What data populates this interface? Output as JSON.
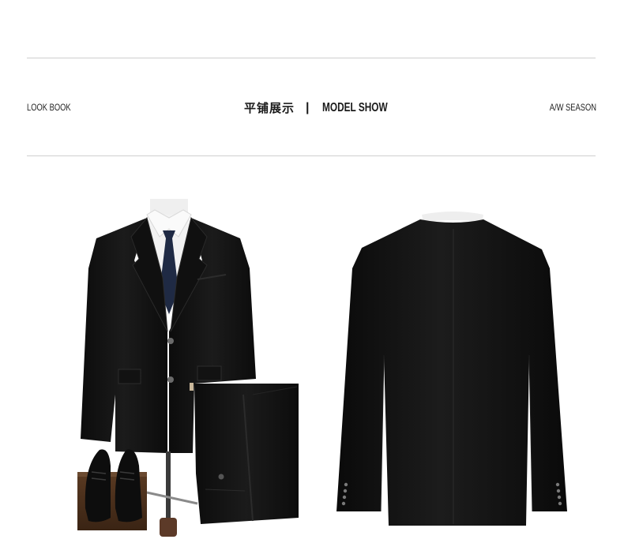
{
  "header": {
    "left_label": "LOOK BOOK",
    "title_cn": "平铺展示",
    "separator": "|",
    "title_en": "MODEL SHOW",
    "right_label": "A/W SEASON"
  },
  "colors": {
    "suit": "#141414",
    "tie": "#1f2a44",
    "shirt": "#f2f2f2",
    "divider": "#cfcfcf",
    "text": "#1a1a1a"
  }
}
